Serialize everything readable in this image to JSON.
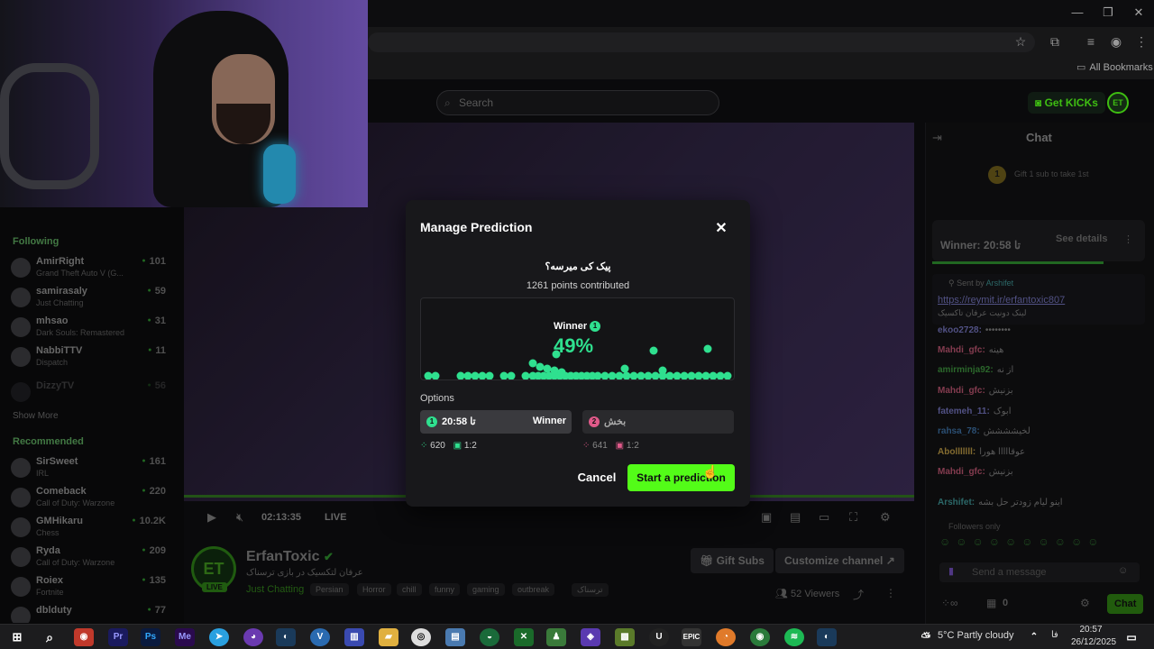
{
  "browser": {
    "bookmarks_label": "All Bookmarks",
    "window_controls": [
      "—",
      "❐",
      "✕"
    ]
  },
  "site": {
    "search_placeholder": "Search",
    "get_kicks_label": "Get KICKs",
    "accent_color": "#53fc18"
  },
  "sidebar": {
    "following_label": "Following",
    "following": [
      {
        "name": "AmirRight",
        "sub": "Grand Theft Auto V (G...",
        "viewers": "101"
      },
      {
        "name": "samirasaly",
        "sub": "Just Chatting",
        "viewers": "59"
      },
      {
        "name": "mhsao",
        "sub": "Dark Souls: Remastered",
        "viewers": "31"
      },
      {
        "name": "NabbiTTV",
        "sub": "Dispatch",
        "viewers": "11"
      },
      {
        "name": "DizzyTV",
        "sub": "",
        "viewers": "56"
      }
    ],
    "show_more_label": "Show More",
    "recommended_label": "Recommended",
    "recommended": [
      {
        "name": "SirSweet",
        "sub": "IRL",
        "viewers": "161"
      },
      {
        "name": "Comeback",
        "sub": "Call of Duty: Warzone",
        "viewers": "220"
      },
      {
        "name": "GMHikaru",
        "sub": "Chess",
        "viewers": "10.2K"
      },
      {
        "name": "Ryda",
        "sub": "Call of Duty: Warzone",
        "viewers": "209"
      },
      {
        "name": "Roiex",
        "sub": "Fortnite",
        "viewers": "135"
      },
      {
        "name": "dblduty",
        "sub": "",
        "viewers": "77"
      }
    ]
  },
  "player": {
    "time": "02:13:35",
    "live_label": "LIVE"
  },
  "channel": {
    "avatar_text": "ET",
    "live_badge": "LIVE",
    "name": "ErfanToxic",
    "title": "عرفان لتکسیک در بازی ترسناک",
    "category": "Just Chatting",
    "tags": [
      "Persian",
      "Horror",
      "chill",
      "funny",
      "gaming",
      "outbreak",
      "ترسناک"
    ],
    "gift_subs_label": "Gift Subs",
    "customize_label": "Customize channel",
    "viewers": "52 Viewers"
  },
  "chat": {
    "title": "Chat",
    "gift_note": "Gift 1 sub to take 1st",
    "prediction_winner": "Winner:",
    "prediction_winner_option": "20:58 تا",
    "see_details": "See details",
    "pinned_by": "Sent by",
    "pinned_user": "Arshifet",
    "pinned_link": "https://reymit.ir/erfantoxic807",
    "pinned_text": "لینک دونیت عرفان تاکسیک",
    "messages": [
      {
        "user": "ekoo2728:",
        "text": "••••••••",
        "color": "#6c6cb0"
      },
      {
        "user": "Mahdi_gfc:",
        "text": "هینه",
        "color": "#b0506a"
      },
      {
        "user": "amirminja92:",
        "text": "از نه",
        "color": "#3a8a3a"
      },
      {
        "user": "Mahdi_gfc:",
        "text": "بزنیش",
        "color": "#b0506a"
      },
      {
        "user": "fatemeh_11:",
        "text": "ابوک",
        "color": "#6c6cb0"
      },
      {
        "user": "rahsa_78:",
        "text": "لخیشششش",
        "color": "#3a6a9a"
      },
      {
        "user": "Abolllllll:",
        "text": "عوقااااا هورا",
        "color": "#b09040"
      },
      {
        "user": "Mahdi_gfc:",
        "text": "بزنیش",
        "color": "#b0506a"
      },
      {
        "user": "Arshifet:",
        "text": "اینو لیام زودتر حل بشه",
        "color": "#3a8a8a"
      }
    ],
    "followers_only": "Followers only",
    "send_placeholder": "Send a message",
    "points_count": "0",
    "chat_button": "Chat"
  },
  "modal": {
    "title": "Manage Prediction",
    "question": "پیک کی میرسه؟",
    "points_contributed": "1261 points contributed",
    "winner_label": "Winner",
    "winner_badge": "1",
    "winner_percent": "49%",
    "options_label": "Options",
    "options": [
      {
        "badge": "1",
        "text": "20:58 تا",
        "winner_tag": "Winner",
        "points": "620",
        "ratio": "1:2",
        "color": "#2fe08f"
      },
      {
        "badge": "2",
        "text": "بخش",
        "points": "641",
        "ratio": "1:2",
        "color": "#e05a8a"
      }
    ],
    "cancel_label": "Cancel",
    "start_label": "Start a prediction"
  },
  "taskbar": {
    "weather": "5°C  Partly cloudy",
    "lang": "فا",
    "time": "20:57",
    "date": "26/12/2025"
  }
}
